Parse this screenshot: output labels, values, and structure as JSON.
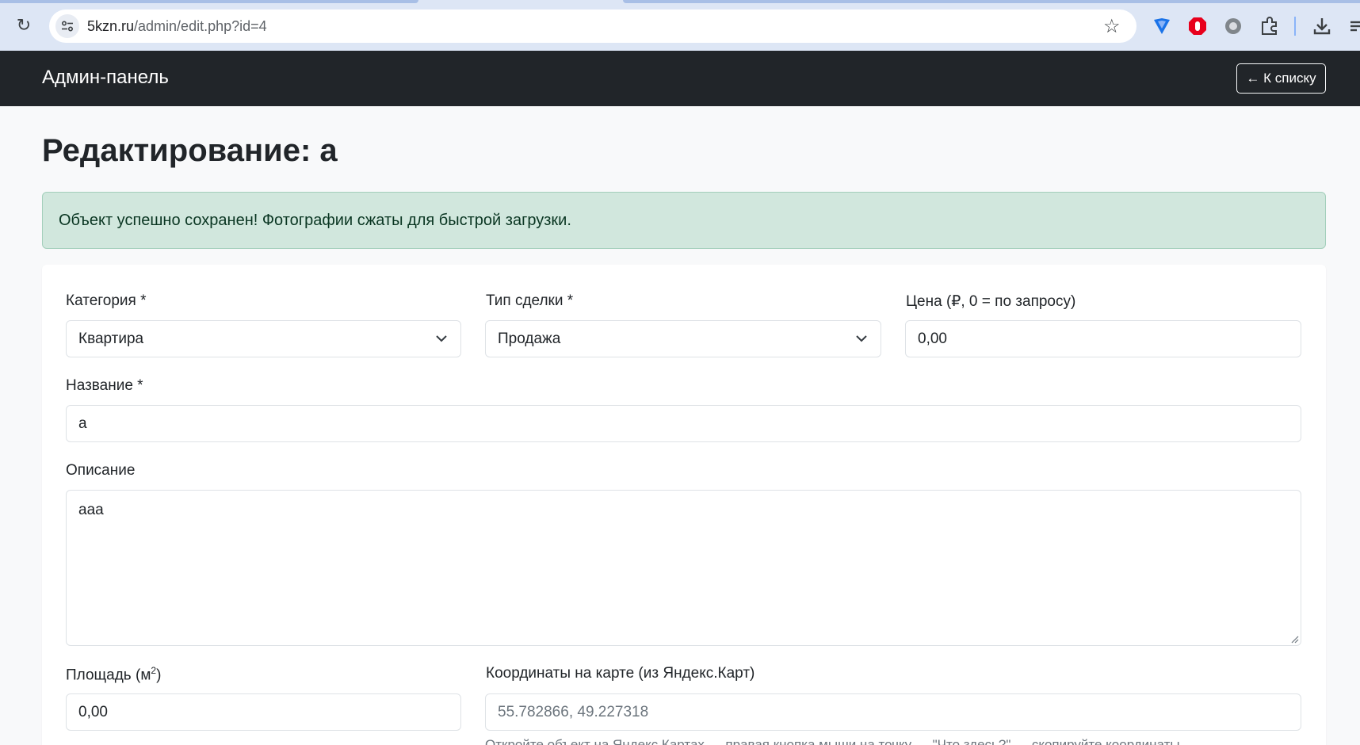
{
  "browser": {
    "url_host": "5kzn.ru",
    "url_path": "/admin/edit.php?id=4"
  },
  "navbar": {
    "brand": "Админ-панель",
    "back_label": "← К списку"
  },
  "page": {
    "title": "Редактирование: а",
    "alert": "Объект успешно сохранен! Фотографии сжаты для быстрой загрузки."
  },
  "form": {
    "category": {
      "label": "Категория *",
      "value": "Квартира"
    },
    "deal_type": {
      "label": "Тип сделки *",
      "value": "Продажа"
    },
    "price": {
      "label": "Цена (₽, 0 = по запросу)",
      "value": "0,00"
    },
    "name": {
      "label": "Название *",
      "value": "а"
    },
    "description": {
      "label": "Описание",
      "value": "ааа"
    },
    "area": {
      "label_main": "Площадь (м",
      "label_sup": "2",
      "label_end": ")",
      "value": "0,00"
    },
    "coords": {
      "label": "Координаты на карте (из Яндекс.Карт)",
      "placeholder": "55.782866, 49.227318"
    },
    "coords_help": "Откройте объект на Яндекс.Картах → правая кнопка мыши на точку → \"Что здесь?\" → скопируйте координаты"
  }
}
